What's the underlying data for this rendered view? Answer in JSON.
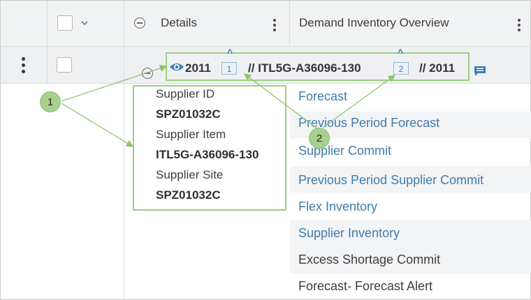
{
  "header": {
    "details_label": "Details",
    "demand_label": "Demand Inventory Overview"
  },
  "row": {
    "year_start": "2011",
    "badge_1": "1",
    "item_code": "// ITL5G-A36096-130",
    "badge_2": "2",
    "year_end": "// 2011"
  },
  "details": [
    {
      "label": "Supplier ID",
      "value": "SPZ01032C"
    },
    {
      "label": "Supplier Item",
      "value": "ITL5G-A36096-130"
    },
    {
      "label": "Supplier Site",
      "value": "SPZ01032C"
    }
  ],
  "measures": [
    {
      "label": "Forecast",
      "link": true
    },
    {
      "label": "Previous Period Forecast",
      "link": true
    },
    {
      "label": "Supplier Commit",
      "link": true
    },
    {
      "label": "Previous Period Supplier Commit",
      "link": true
    },
    {
      "label": "Flex Inventory",
      "link": true
    },
    {
      "label": "Supplier Inventory",
      "link": true
    },
    {
      "label": "Excess Shortage Commit",
      "link": false
    },
    {
      "label": "Forecast- Forecast Alert",
      "link": false
    }
  ],
  "callouts": {
    "one": "1",
    "two": "2"
  },
  "colors": {
    "link": "#3f7cad",
    "plain_text": "#3e3e3e",
    "callout_fill": "#a8d08d",
    "callout_border": "#9bcf83",
    "header_bg": "#f1f2f4",
    "stripe_bg": "#f3f4f6"
  },
  "icons": {
    "row_actions": "kebab-icon",
    "header_actions": "kebab-icon",
    "collapse": "minus-circle-icon",
    "view": "eye-icon",
    "note": "note-icon",
    "expand": "chevron-down-icon",
    "badge_caret": "caret-up-icon"
  }
}
